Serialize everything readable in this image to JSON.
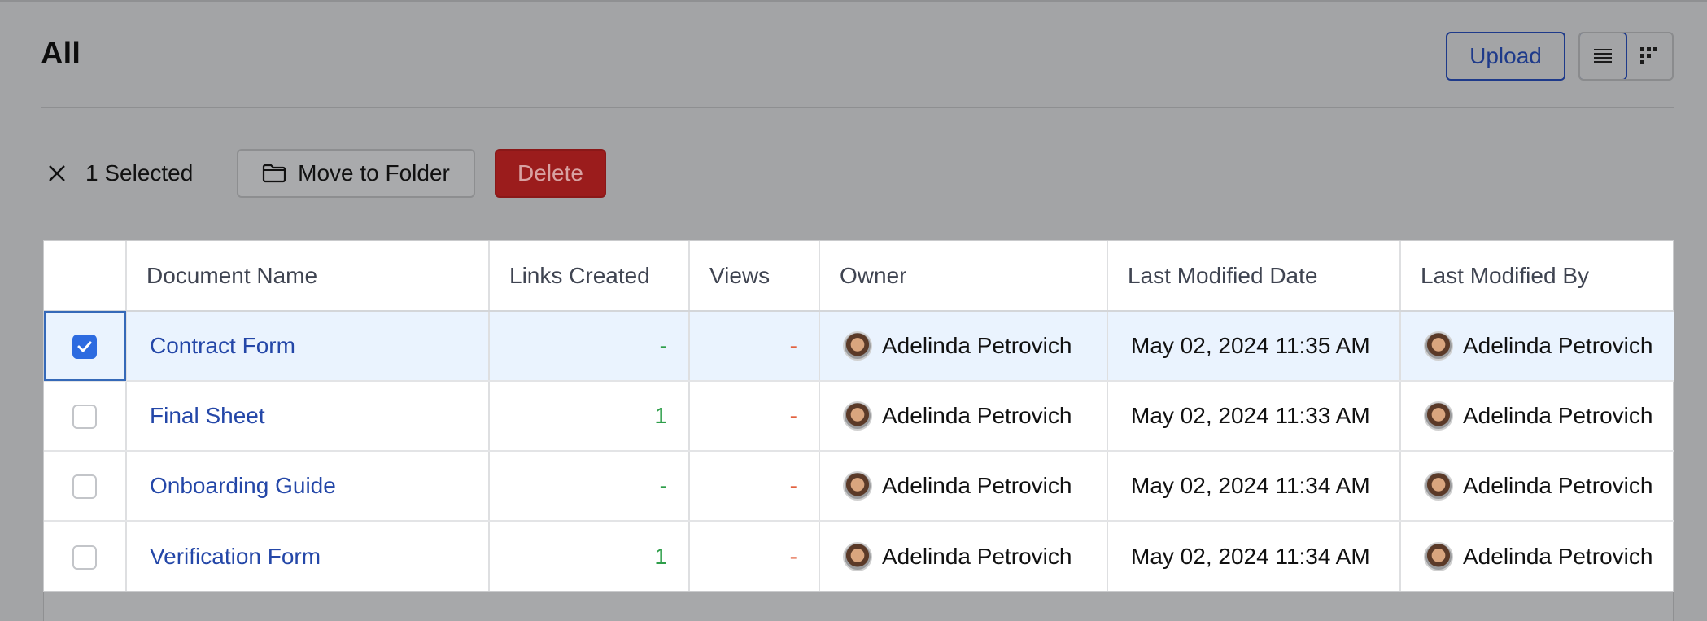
{
  "header": {
    "title": "All",
    "upload_label": "Upload",
    "view_modes": [
      "list-view-icon",
      "grid-view-icon"
    ]
  },
  "selection_bar": {
    "selected_text": "1 Selected",
    "move_label": "Move to Folder",
    "delete_label": "Delete"
  },
  "table": {
    "columns": [
      "Document Name",
      "Links Created",
      "Views",
      "Owner",
      "Last Modified Date",
      "Last Modified By"
    ],
    "rows": [
      {
        "checked": true,
        "name": "Contract Form",
        "links": "-",
        "views": "-",
        "owner": "Adelinda Petrovich",
        "modified": "May 02, 2024 11:35 AM",
        "modified_by": "Adelinda Petrovich"
      },
      {
        "checked": false,
        "name": "Final Sheet",
        "links": "1",
        "views": "-",
        "owner": "Adelinda Petrovich",
        "modified": "May 02, 2024 11:33 AM",
        "modified_by": "Adelinda Petrovich"
      },
      {
        "checked": false,
        "name": "Onboarding Guide",
        "links": "-",
        "views": "-",
        "owner": "Adelinda Petrovich",
        "modified": "May 02, 2024 11:34 AM",
        "modified_by": "Adelinda Petrovich"
      },
      {
        "checked": false,
        "name": "Verification Form",
        "links": "1",
        "views": "-",
        "owner": "Adelinda Petrovich",
        "modified": "May 02, 2024 11:34 AM",
        "modified_by": "Adelinda Petrovich"
      }
    ]
  },
  "colors": {
    "primary": "#1e3a8a",
    "link": "#2447a8",
    "danger": "#9b1c1c",
    "links_value": "#2e9e4a",
    "views_value": "#e2613f",
    "checkbox_checked": "#2d6be0"
  }
}
